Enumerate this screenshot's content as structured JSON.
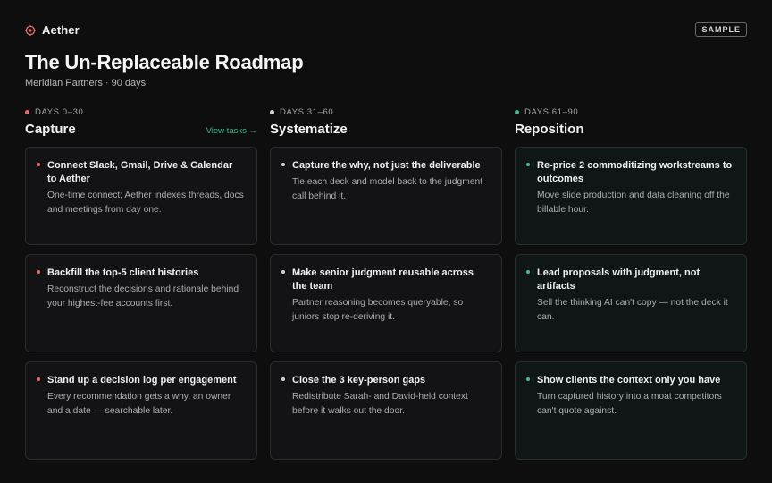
{
  "brand": {
    "name": "Aether",
    "icon": "target-icon",
    "accent": "#e86a6a"
  },
  "badge": "SAMPLE",
  "header": {
    "title": "The Un-Replaceable Roadmap",
    "subtitle": "Meridian Partners · 90 days"
  },
  "columns": [
    {
      "phase": "DAYS 0–30",
      "title": "Capture",
      "link": "View tasks →",
      "color": "#e86a6a",
      "cards": [
        {
          "title": "Connect Slack, Gmail, Drive & Calendar to Aether",
          "desc": "One-time connect; Aether indexes threads, docs and meetings from day one."
        },
        {
          "title": "Backfill the top-5 client histories",
          "desc": "Reconstruct the decisions and rationale behind your highest-fee accounts first."
        },
        {
          "title": "Stand up a decision log per engagement",
          "desc": "Every recommendation gets a why, an owner and a date — searchable later."
        }
      ]
    },
    {
      "phase": "DAYS 31–60",
      "title": "Systematize",
      "color": "#d4d4d6",
      "cards": [
        {
          "title": "Capture the why, not just the deliverable",
          "desc": "Tie each deck and model back to the judgment call behind it."
        },
        {
          "title": "Make senior judgment reusable across the team",
          "desc": "Partner reasoning becomes queryable, so juniors stop re-deriving it."
        },
        {
          "title": "Close the 3 key-person gaps",
          "desc": "Redistribute Sarah- and David-held context before it walks out the door."
        }
      ]
    },
    {
      "phase": "DAYS 61–90",
      "title": "Reposition",
      "color": "#3fbf8f",
      "cards": [
        {
          "title": "Re-price 2 commoditizing workstreams to outcomes",
          "desc": "Move slide production and data cleaning off the billable hour."
        },
        {
          "title": "Lead proposals with judgment, not artifacts",
          "desc": "Sell the thinking AI can't copy — not the deck it can."
        },
        {
          "title": "Show clients the context only you have",
          "desc": "Turn captured history into a moat competitors can't quote against."
        }
      ]
    }
  ]
}
